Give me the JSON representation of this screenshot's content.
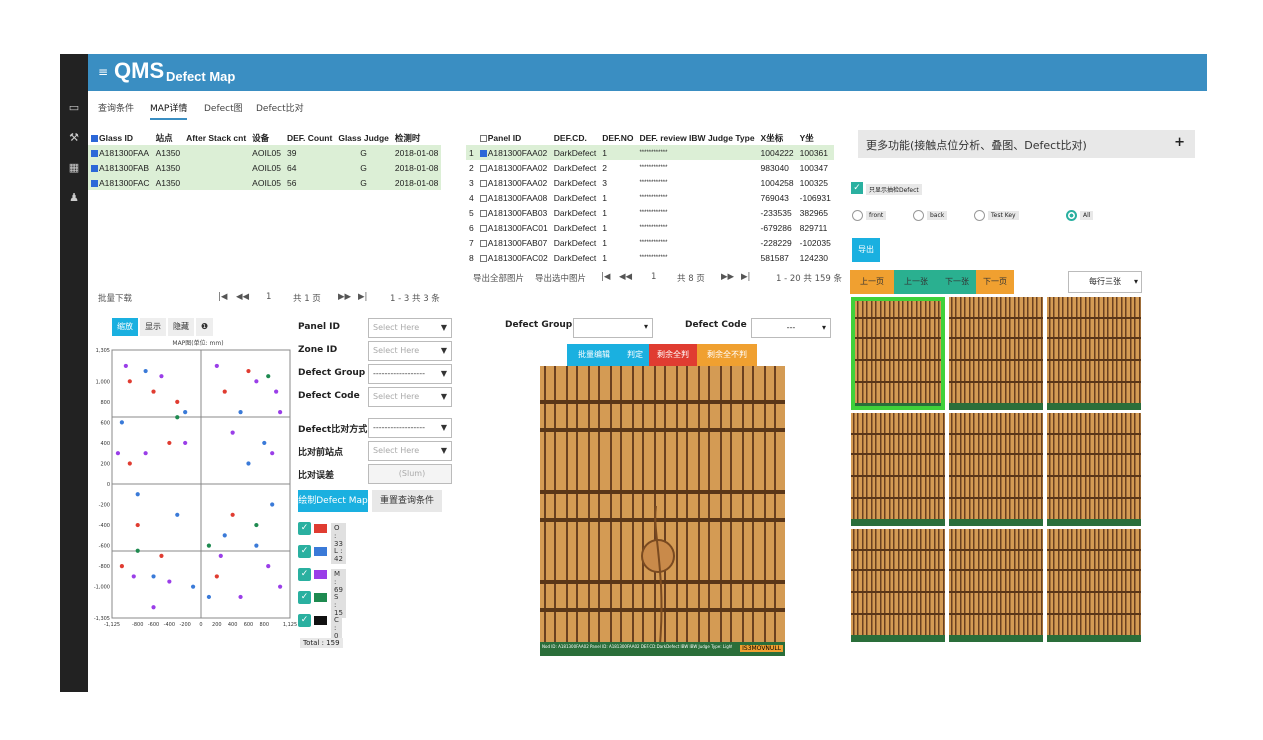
{
  "app": {
    "name": "QMS",
    "subtitle": "Defect Map"
  },
  "tabs": [
    {
      "label": "查询条件"
    },
    {
      "label": "MAP详情"
    },
    {
      "label": "Defect图"
    },
    {
      "label": "Defect比对"
    }
  ],
  "glass_table": {
    "headers": [
      "Glass ID",
      "站点",
      "After Stack cnt",
      "设备",
      "DEF. Count",
      "Glass Judge",
      "检测时"
    ],
    "rows": [
      [
        "A181300FAA",
        "A1350",
        "",
        "AOIL05",
        "39",
        "G",
        "2018-01-08"
      ],
      [
        "A181300FAB",
        "A1350",
        "",
        "AOIL05",
        "64",
        "G",
        "2018-01-08"
      ],
      [
        "A181300FAC",
        "A1350",
        "",
        "AOIL05",
        "56",
        "G",
        "2018-01-08"
      ]
    ]
  },
  "glass_pager": {
    "label": "批量下载",
    "page": "1",
    "total_pages": "共 1 页",
    "range": "1 - 3  共 3 条"
  },
  "panel_table": {
    "headers": [
      "Panel ID",
      "DEF.CD.",
      "DEF.NO",
      "DEF. review IBW Judge Type",
      "X坐标",
      "Y坐"
    ],
    "rows": [
      [
        "1",
        "A181300FAA02",
        "DarkDefect",
        "1",
        "************",
        "1004222",
        "100361"
      ],
      [
        "2",
        "A181300FAA02",
        "DarkDefect",
        "2",
        "************",
        "983040",
        "100347"
      ],
      [
        "3",
        "A181300FAA02",
        "DarkDefect",
        "3",
        "************",
        "1004258",
        "100325"
      ],
      [
        "4",
        "A181300FAA08",
        "DarkDefect",
        "1",
        "************",
        "769043",
        "-106931"
      ],
      [
        "5",
        "A181300FAB03",
        "DarkDefect",
        "1",
        "************",
        "-233535",
        "382965"
      ],
      [
        "6",
        "A181300FAC01",
        "DarkDefect",
        "1",
        "************",
        "-679286",
        "829711"
      ],
      [
        "7",
        "A181300FAB07",
        "DarkDefect",
        "1",
        "************",
        "-228229",
        "-102035"
      ],
      [
        "8",
        "A181300FAC02",
        "DarkDefect",
        "1",
        "************",
        "581587",
        "124230"
      ]
    ]
  },
  "panel_pager": {
    "export_all": "导出全部图片",
    "export_sel": "导出选中图片",
    "page": "1",
    "total_pages": "共 8 页",
    "range": "1 - 20  共 159 条"
  },
  "map": {
    "buttons": {
      "zoom": "缩放",
      "show": "显示",
      "hide": "隐藏",
      "info": "❶"
    },
    "title": "MAP图(单位: mm)",
    "y_ticks": [
      "1,305",
      "1,000",
      "800",
      "600",
      "400",
      "200",
      "0",
      "-200",
      "-400",
      "-600",
      "-800",
      "-1,000",
      "-1,305"
    ],
    "x_ticks": [
      "-1,125",
      "-800",
      "-600",
      "-400",
      "-200",
      "0",
      "200",
      "400",
      "600",
      "800",
      "1,125"
    ]
  },
  "chart_data": {
    "type": "scatter",
    "title": "MAP图(单位: mm)",
    "xlim": [
      -1125,
      1125
    ],
    "ylim": [
      -1305,
      1305
    ],
    "series": [
      {
        "name": "O",
        "color": "#e03c31",
        "values": [
          [
            -900,
            1000
          ],
          [
            -600,
            900
          ],
          [
            -300,
            800
          ],
          [
            -900,
            200
          ],
          [
            -400,
            400
          ],
          [
            300,
            900
          ],
          [
            600,
            1100
          ],
          [
            -1000,
            -800
          ],
          [
            -500,
            -700
          ],
          [
            200,
            -900
          ],
          [
            -800,
            -400
          ],
          [
            400,
            -300
          ]
        ]
      },
      {
        "name": "L",
        "color": "#3a7ad8",
        "values": [
          [
            -700,
            1100
          ],
          [
            -200,
            700
          ],
          [
            500,
            700
          ],
          [
            800,
            400
          ],
          [
            -800,
            -100
          ],
          [
            -300,
            -300
          ],
          [
            300,
            -500
          ],
          [
            700,
            -600
          ],
          [
            -600,
            -900
          ],
          [
            100,
            -1100
          ],
          [
            900,
            -200
          ],
          [
            -1000,
            600
          ],
          [
            600,
            200
          ],
          [
            -100,
            -1000
          ]
        ]
      },
      {
        "name": "M",
        "color": "#9a3ee8",
        "values": [
          [
            -950,
            1150
          ],
          [
            -500,
            1050
          ],
          [
            200,
            1150
          ],
          [
            700,
            1000
          ],
          [
            950,
            900
          ],
          [
            1000,
            700
          ],
          [
            -1050,
            300
          ],
          [
            -700,
            300
          ],
          [
            -200,
            400
          ],
          [
            400,
            500
          ],
          [
            900,
            300
          ],
          [
            -850,
            -900
          ],
          [
            -400,
            -950
          ],
          [
            250,
            -700
          ],
          [
            850,
            -800
          ],
          [
            -600,
            -1200
          ],
          [
            500,
            -1100
          ],
          [
            1000,
            -1000
          ]
        ]
      },
      {
        "name": "S",
        "color": "#1e8a50",
        "values": [
          [
            850,
            1050
          ],
          [
            -300,
            650
          ],
          [
            -800,
            -650
          ],
          [
            700,
            -400
          ],
          [
            100,
            -600
          ]
        ]
      },
      {
        "name": "C",
        "color": "#111111",
        "values": []
      }
    ]
  },
  "form": {
    "panel_id": {
      "label": "Panel ID",
      "placeholder": "Select Here"
    },
    "zone_id": {
      "label": "Zone ID",
      "placeholder": "Select Here"
    },
    "defect_group": {
      "label": "Defect Group",
      "value": "------------------"
    },
    "defect_code": {
      "label": "Defect Code",
      "placeholder": "Select Here"
    },
    "compare_method": {
      "label": "Defect比对方式",
      "value": "------------------"
    },
    "compare_station": {
      "label": "比对前站点",
      "placeholder": "Select Here"
    },
    "compare_error": {
      "label": "比对误差",
      "placeholder": "(Slum)"
    },
    "draw_btn": "绘制Defect Map",
    "reset_btn": "重置查询条件"
  },
  "legend": [
    {
      "label": "O : 33",
      "color": "#e03c31"
    },
    {
      "label": "L : 42",
      "color": "#3a7ad8"
    },
    {
      "label": "M : 69",
      "color": "#9a3ee8"
    },
    {
      "label": "S : 15",
      "color": "#1e8a50"
    },
    {
      "label": "C : 0",
      "color": "#111111"
    }
  ],
  "legend_total": "Total : 159",
  "mid": {
    "group_label": "Defect Group",
    "code_label": "Defect Code",
    "code_value": "---",
    "batch_edit": "批量编辑",
    "judge": "判定",
    "rest_all": "剩余全判",
    "rest_none": "剩余全不判",
    "caption": "Nod ID: A181300FAA02 Panel ID: A181300FAA02 DEF.CD:DarkDefect IBW IBW Judge Type: Light IDK: PT1-3 | XY:1004222,100361 Zone: A",
    "stamp": "IS3MOVNULL"
  },
  "right": {
    "header": "更多功能(接触点位分析、叠图、Defect比对)",
    "plus": "+",
    "only_label": "只显示抽检Defect",
    "radios": [
      "front",
      "back",
      "Test Key",
      "All"
    ],
    "export": "导出",
    "prev_page": "上一页",
    "prev_one": "上一张",
    "next_one": "下一张",
    "next_page": "下一页",
    "per_row": "每行三张"
  }
}
